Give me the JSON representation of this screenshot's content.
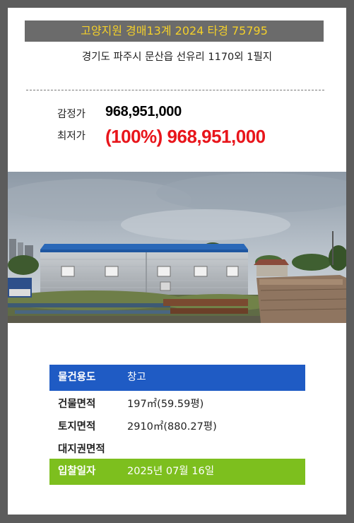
{
  "header": {
    "title": "고양지원 경매13계 2024 타경 75795",
    "address": "경기도 파주시 문산읍 선유리 1170외 1필지"
  },
  "prices": {
    "appraisal_label": "감정가",
    "appraisal_value": "968,951,000",
    "minimum_label": "최저가",
    "minimum_value": "(100%) 968,951,000"
  },
  "photo": {
    "subject": "warehouse-photo"
  },
  "details": {
    "use_label": "물건용도",
    "use_value": "창고",
    "building_area_label": "건물면적",
    "building_area_value": "197㎡(59.59평)",
    "land_area_label": "토지면적",
    "land_area_value": "2910㎡(880.27평)",
    "land_right_label": "대지권면적",
    "land_right_value": "",
    "bid_date_label": "입찰일자",
    "bid_date_value": "2025년 07월 16일"
  },
  "colors": {
    "title_bg": "#6b6b6b",
    "title_text": "#f3cf2a",
    "price_red": "#e8151b",
    "row_blue": "#1f5bc4",
    "row_green": "#7dbf1e"
  }
}
